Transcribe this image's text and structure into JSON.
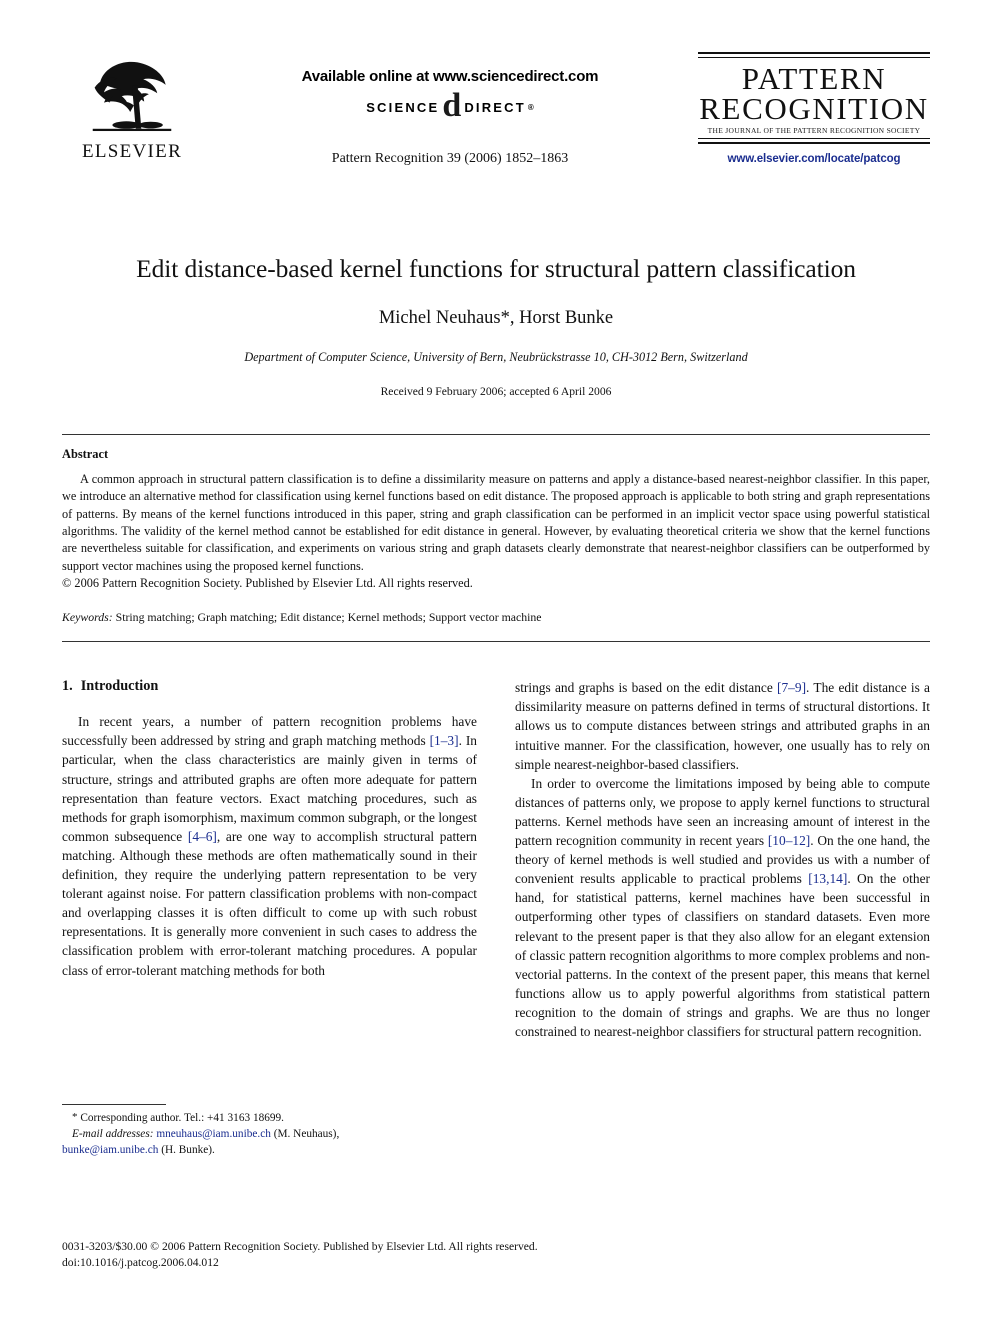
{
  "masthead": {
    "publisher_name": "ELSEVIER",
    "publisher_logo_icon": "elsevier-tree-icon",
    "available_online": "Available online at www.sciencedirect.com",
    "sciencedirect_logo": {
      "left_word": "SCIENCE",
      "mark": "d",
      "right_word": "DIRECT",
      "registered_mark": "®"
    },
    "journal_reference": "Pattern Recognition 39 (2006) 1852–1863",
    "journal_logo": {
      "line1": "PATTERN",
      "line2": "RECOGNITION",
      "subtitle": "THE JOURNAL OF THE PATTERN RECOGNITION SOCIETY",
      "url": "www.elsevier.com/locate/patcog",
      "url_color": "#1a2d8f"
    }
  },
  "article": {
    "title": "Edit distance-based kernel functions for structural pattern classification",
    "authors": "Michel Neuhaus*, Horst Bunke",
    "affiliation": "Department of Computer Science, University of Bern, Neubrückstrasse 10, CH-3012 Bern, Switzerland",
    "history": "Received 9 February 2006; accepted 6 April 2006"
  },
  "abstract": {
    "heading": "Abstract",
    "body": "A common approach in structural pattern classification is to define a dissimilarity measure on patterns and apply a distance-based nearest-neighbor classifier. In this paper, we introduce an alternative method for classification using kernel functions based on edit distance. The proposed approach is applicable to both string and graph representations of patterns. By means of the kernel functions introduced in this paper, string and graph classification can be performed in an implicit vector space using powerful statistical algorithms. The validity of the kernel method cannot be established for edit distance in general. However, by evaluating theoretical criteria we show that the kernel functions are nevertheless suitable for classification, and experiments on various string and graph datasets clearly demonstrate that nearest-neighbor classifiers can be outperformed by support vector machines using the proposed kernel functions.",
    "copyright": "© 2006 Pattern Recognition Society. Published by Elsevier Ltd. All rights reserved.",
    "keywords_label": "Keywords:",
    "keywords_text": "String matching; Graph matching; Edit distance; Kernel methods; Support vector machine"
  },
  "section": {
    "number": "1.",
    "title": "Introduction"
  },
  "body_text": {
    "left_p1_a": "In recent years, a number of pattern recognition problems have successfully been addressed by string and graph matching methods ",
    "left_p1_cite1": "[1–3]",
    "left_p1_b": ". In particular, when the class characteristics are mainly given in terms of structure, strings and attributed graphs are often more adequate for pattern representation than feature vectors. Exact matching procedures, such as methods for graph isomorphism, maximum common subgraph, or the longest common subsequence ",
    "left_p1_cite2": "[4–6]",
    "left_p1_c": ", are one way to accomplish structural pattern matching. Although these methods are often mathematically sound in their definition, they require the underlying pattern representation to be very tolerant against noise. For pattern classification problems with non-compact and overlapping classes it is often difficult to come up with such robust representations. It is generally more convenient in such cases to address the classification problem with error-tolerant matching procedures. A popular class of error-tolerant matching methods for both",
    "right_p1_a": "strings and graphs is based on the edit distance ",
    "right_p1_cite1": "[7–9]",
    "right_p1_b": ". The edit distance is a dissimilarity measure on patterns defined in terms of structural distortions. It allows us to compute distances between strings and attributed graphs in an intuitive manner. For the classification, however, one usually has to rely on simple nearest-neighbor-based classifiers.",
    "right_p2_a": "In order to overcome the limitations imposed by being able to compute distances of patterns only, we propose to apply kernel functions to structural patterns. Kernel methods have seen an increasing amount of interest in the pattern recognition community in recent years ",
    "right_p2_cite1": "[10–12]",
    "right_p2_b": ". On the one hand, the theory of kernel methods is well studied and provides us with a number of convenient results applicable to practical problems ",
    "right_p2_cite2": "[13,14]",
    "right_p2_c": ". On the other hand, for statistical patterns, kernel machines have been successful in outperforming other types of classifiers on standard datasets. Even more relevant to the present paper is that they also allow for an elegant extension of classic pattern recognition algorithms to more complex problems and non-vectorial patterns. In the context of the present paper, this means that kernel functions allow us to apply powerful algorithms from statistical pattern recognition to the domain of strings and graphs. We are thus no longer constrained to nearest-neighbor classifiers for structural pattern recognition."
  },
  "footnotes": {
    "corresponding_marker": "*",
    "corresponding_text": " Corresponding author. Tel.: +41 3163 18699.",
    "email_label": "E-mail addresses:",
    "email1": "mneuhaus@iam.unibe.ch",
    "email1_owner": " (M. Neuhaus),",
    "email2": "bunke@iam.unibe.ch",
    "email2_owner": " (H. Bunke)."
  },
  "imprint": {
    "line1": "0031-3203/$30.00 © 2006 Pattern Recognition Society. Published by Elsevier Ltd. All rights reserved.",
    "line2": "doi:10.1016/j.patcog.2006.04.012"
  }
}
